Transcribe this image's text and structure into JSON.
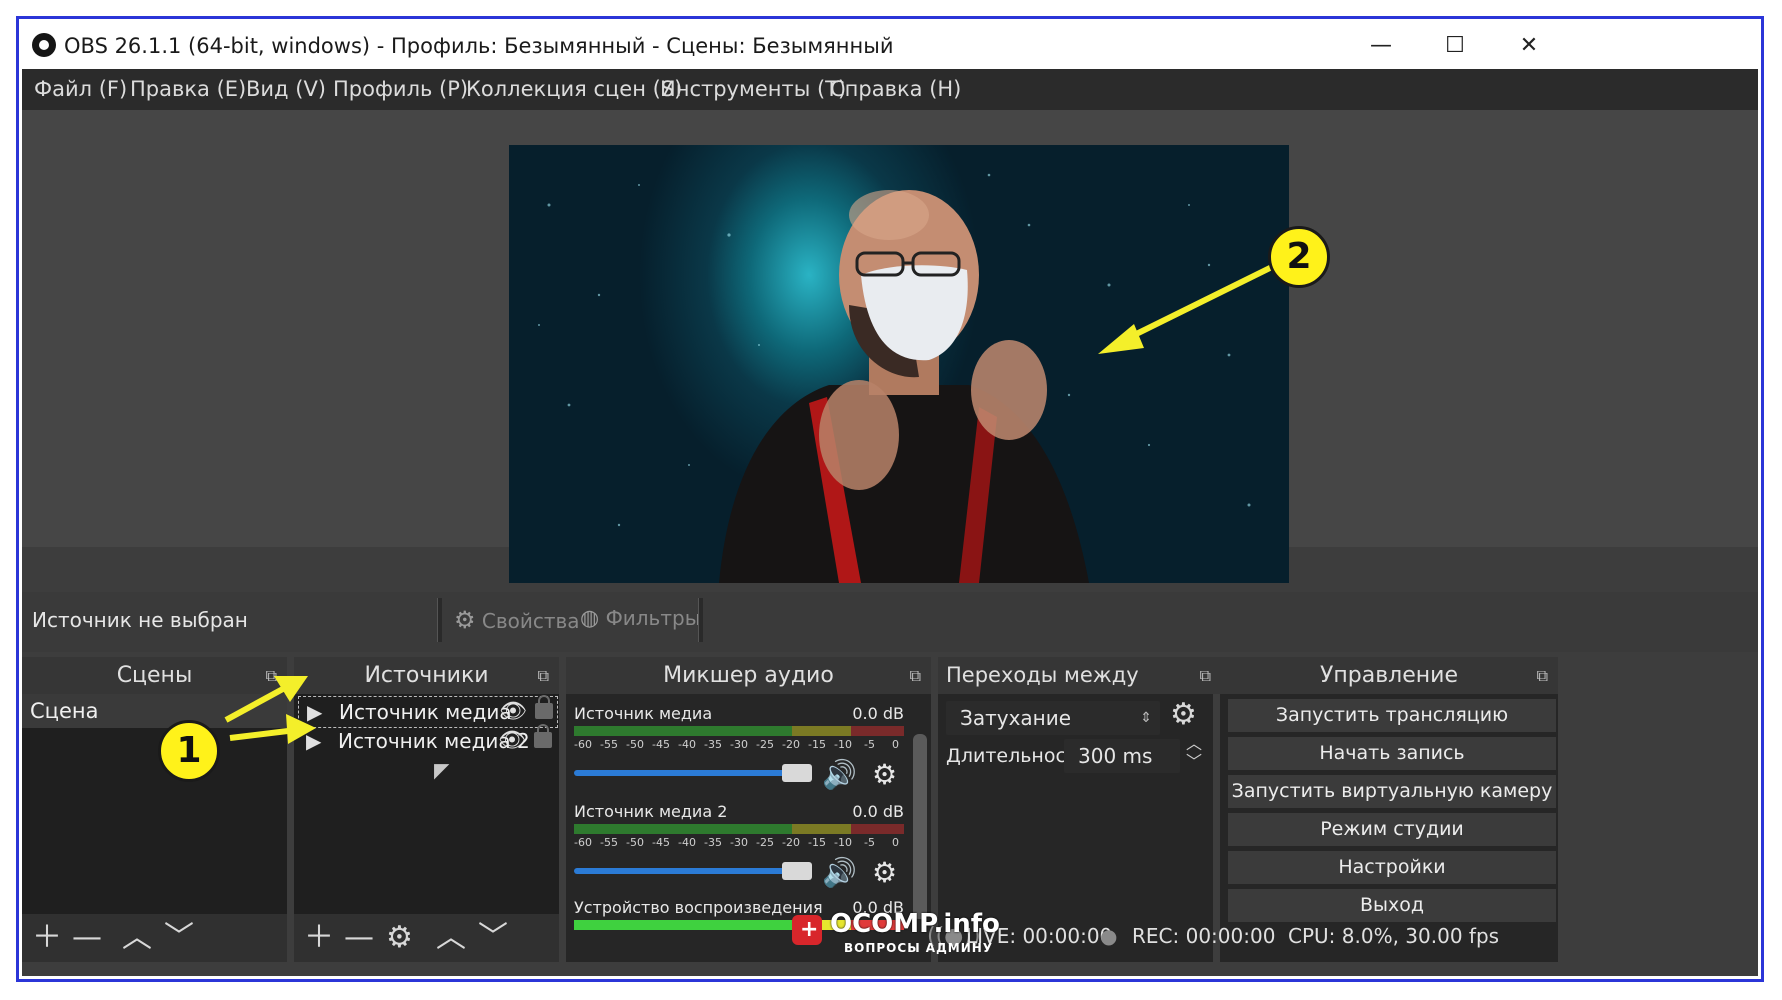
{
  "window": {
    "title": "OBS 26.1.1 (64-bit, windows) - Профиль: Безымянный - Сцены: Безымянный"
  },
  "menu": [
    "Файл (F)",
    "Правка (E)",
    "Вид (V)",
    "Профиль (P)",
    "Коллекция сцен (S)",
    "Инструменты (T)",
    "Справка (H)"
  ],
  "info_bar": {
    "no_source": "Источник не выбран",
    "properties": "Свойства",
    "filters": "Фильтры"
  },
  "scenes": {
    "title": "Сцены",
    "items": [
      "Сцена"
    ]
  },
  "sources": {
    "title": "Источники",
    "items": [
      "Источник медиа",
      "Источник медиа 2"
    ]
  },
  "mixer": {
    "title": "Микшер аудио",
    "ticks": [
      "-60",
      "-55",
      "-50",
      "-45",
      "-40",
      "-35",
      "-30",
      "-25",
      "-20",
      "-15",
      "-10",
      "-5",
      "0"
    ],
    "channels": [
      {
        "name": "Источник медиа",
        "db": "0.0 dB"
      },
      {
        "name": "Источник медиа 2",
        "db": "0.0 dB"
      },
      {
        "name": "Устройство воспроизведения",
        "db": "0.0 dB"
      }
    ]
  },
  "transitions": {
    "title": "Переходы между сценами",
    "type": "Затухание",
    "duration_label": "Длительность",
    "duration_value": "300 ms"
  },
  "controls": {
    "title": "Управление",
    "buttons": [
      "Запустить трансляцию",
      "Начать запись",
      "Запустить виртуальную камеру",
      "Режим студии",
      "Настройки",
      "Выход"
    ]
  },
  "status": {
    "live": "LIVE: 00:00:00",
    "rec": "REC: 00:00:00",
    "cpu": "CPU: 8.0%, 30.00 fps"
  },
  "annotations": {
    "badge1": "1",
    "badge2": "2"
  },
  "watermark": {
    "brand": "OCOMP.info",
    "tagline": "ВОПРОСЫ АДМИНУ"
  },
  "colors": {
    "frame": "#2b35d8",
    "badge": "#fff21a",
    "arrow": "#f4ef2a",
    "fader": "#2b7bd6"
  }
}
